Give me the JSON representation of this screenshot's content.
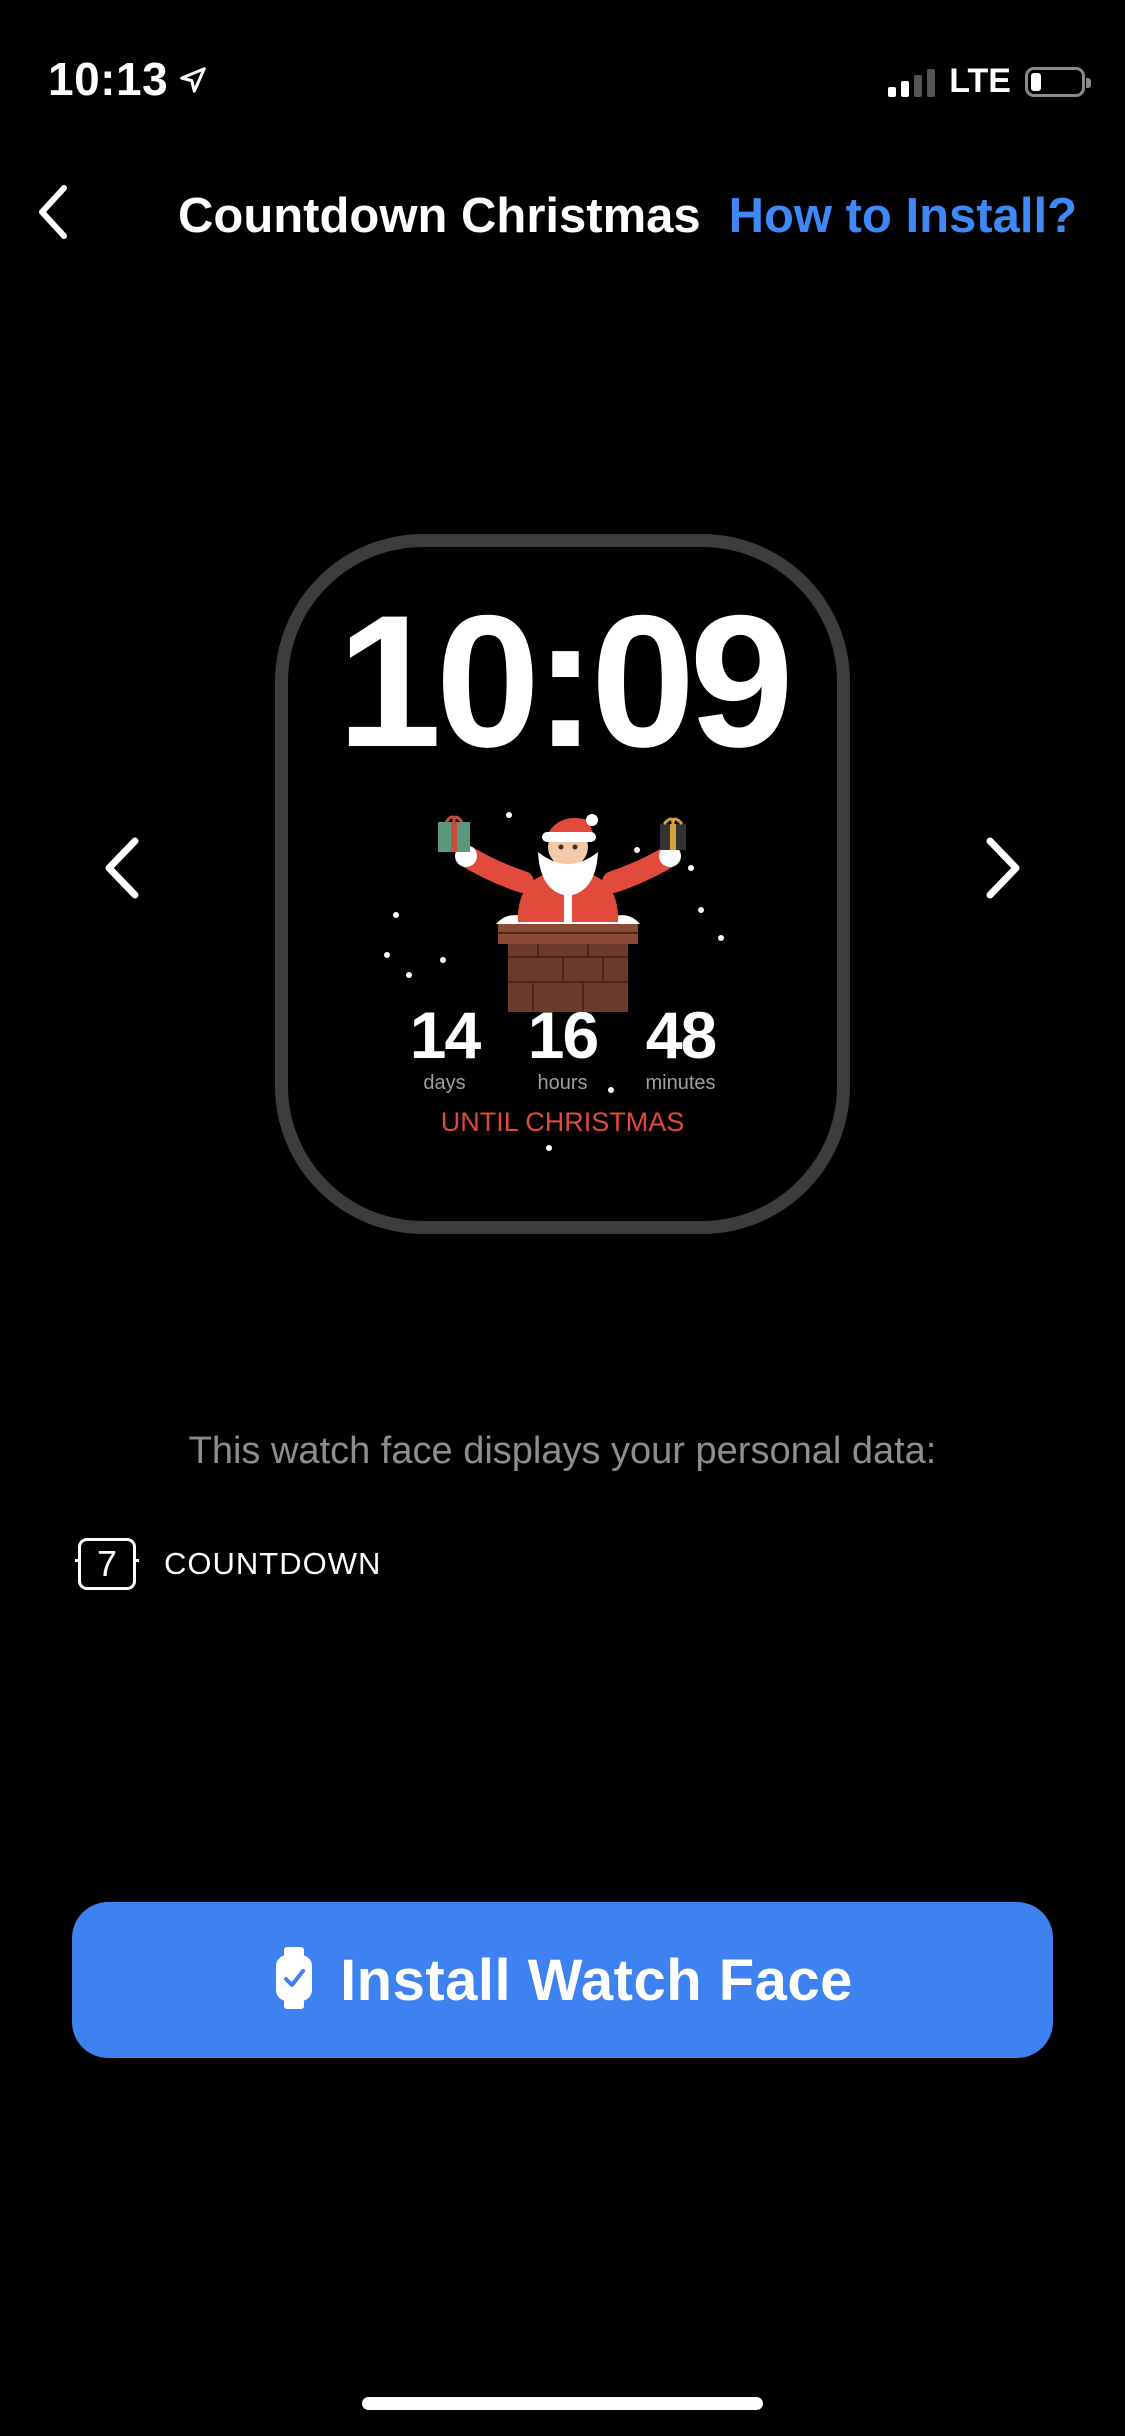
{
  "status_bar": {
    "time": "10:13",
    "network": "LTE",
    "icons": [
      "location-arrow-icon",
      "signal-icon",
      "battery-icon"
    ]
  },
  "nav": {
    "back_icon": "chevron-left-icon",
    "title": "Countdown Christmas",
    "help_link": "How to Install?"
  },
  "watch_preview": {
    "time": "10:09",
    "countdown": [
      {
        "value": "14",
        "label": "days"
      },
      {
        "value": "16",
        "label": "hours"
      },
      {
        "value": "48",
        "label": "minutes"
      }
    ],
    "until_label": "UNTIL CHRISTMAS",
    "prev_icon": "chevron-left-icon",
    "next_icon": "chevron-right-icon"
  },
  "personal_data": {
    "heading": "This watch face displays your personal data:",
    "items": [
      {
        "icon": "countdown-icon",
        "icon_text": "7",
        "label": "COUNTDOWN"
      }
    ]
  },
  "install": {
    "label": "Install Watch Face",
    "icon": "watch-icon"
  },
  "colors": {
    "accent": "#3e82f1",
    "link": "#3f88f7",
    "background": "#000000",
    "countdown_red": "#e04a3c"
  }
}
